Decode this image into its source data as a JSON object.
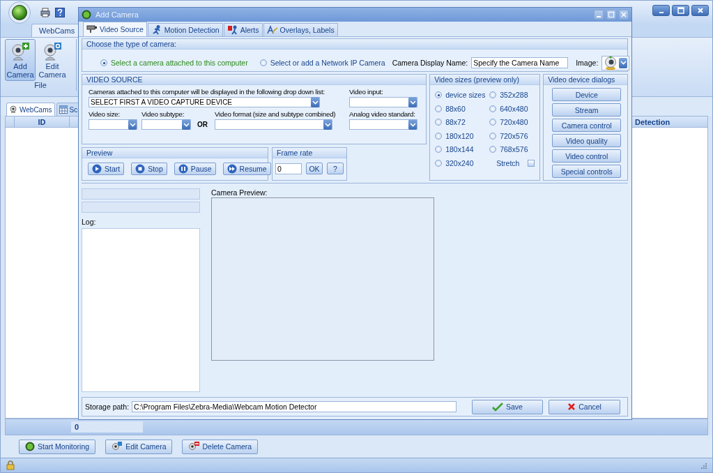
{
  "ribbon": {
    "tab": "WebCams",
    "group": {
      "label": "File",
      "buttons": [
        {
          "label": "Add Camera",
          "kind": "add",
          "selected": true
        },
        {
          "label": "Edit Camera",
          "kind": "edit",
          "selected": false
        }
      ]
    }
  },
  "main_tabs": [
    {
      "label": "WebCams",
      "selected": true
    },
    {
      "label": "Sc",
      "selected": false
    }
  ],
  "table": {
    "columns": [
      "ID",
      "Detection"
    ]
  },
  "status": {
    "count": "0"
  },
  "bottom_buttons": [
    {
      "label": "Start Monitoring",
      "kind": "start"
    },
    {
      "label": "Edit Camera",
      "kind": "edit"
    },
    {
      "label": "Delete Camera",
      "kind": "delete"
    }
  ],
  "dialog": {
    "title": "Add Camera",
    "tabs": [
      {
        "label": "Video Source",
        "kind": "source",
        "selected": true
      },
      {
        "label": "Motion Detection",
        "kind": "motion",
        "selected": false
      },
      {
        "label": "Alerts",
        "kind": "alerts",
        "selected": false
      },
      {
        "label": "Overlays, Labels",
        "kind": "overlays",
        "selected": false
      }
    ],
    "camera_type": {
      "heading": "Choose the type of camera:",
      "options": [
        {
          "label": "Select a camera attached to this computer",
          "selected": true
        },
        {
          "label": "Select or add a Network IP Camera",
          "selected": false
        }
      ],
      "display_name_label": "Camera Display Name:",
      "display_name": "Specify the Camera Name",
      "image_label": "Image:"
    },
    "video_source": {
      "heading": "VIDEO SOURCE",
      "cameras_label": "Cameras attached to this computer will be displayed in the following drop down list:",
      "camera_select": "SELECT FIRST A VIDEO CAPTURE DEVICE",
      "video_input_label": "Video input:",
      "video_size_label": "Video size:",
      "video_subtype_label": "Video subtype:",
      "or": "OR",
      "video_format_label": "Video format (size and subtype combined)",
      "analog_label": "Analog video standard:"
    },
    "preview": {
      "heading": "Preview",
      "buttons": [
        {
          "label": "Start",
          "kind": "play"
        },
        {
          "label": "Stop",
          "kind": "stop"
        },
        {
          "label": "Pause",
          "kind": "pause"
        },
        {
          "label": "Resume",
          "kind": "resume"
        }
      ]
    },
    "frame_rate": {
      "heading": "Frame rate",
      "value": "0",
      "buttons": [
        "OK",
        "?"
      ]
    },
    "video_sizes": {
      "heading": "Video sizes (preview only)",
      "options": [
        {
          "label": "device sizes",
          "selected": true
        },
        {
          "label": "352x288",
          "selected": false
        },
        {
          "label": "88x60",
          "selected": false
        },
        {
          "label": "640x480",
          "selected": false
        },
        {
          "label": "88x72",
          "selected": false
        },
        {
          "label": "720x480",
          "selected": false
        },
        {
          "label": "180x120",
          "selected": false
        },
        {
          "label": "720x576",
          "selected": false
        },
        {
          "label": "180x144",
          "selected": false
        },
        {
          "label": "768x576",
          "selected": false
        },
        {
          "label": "320x240",
          "selected": false
        }
      ],
      "stretch": {
        "label": "Stretch",
        "checked": false
      }
    },
    "device_dialogs": {
      "heading": "Video device dialogs",
      "buttons": [
        "Device",
        "Stream",
        "Camera control",
        "Video quality",
        "Video control",
        "Special controls"
      ]
    },
    "log_label": "Log:",
    "camera_preview_label": "Camera Preview:",
    "storage_label": "Storage path:",
    "storage_path": "C:\\Program Files\\Zebra-Media\\Webcam Motion Detector",
    "actions": [
      {
        "label": "Save",
        "kind": "save"
      },
      {
        "label": "Cancel",
        "kind": "cancel"
      }
    ]
  }
}
